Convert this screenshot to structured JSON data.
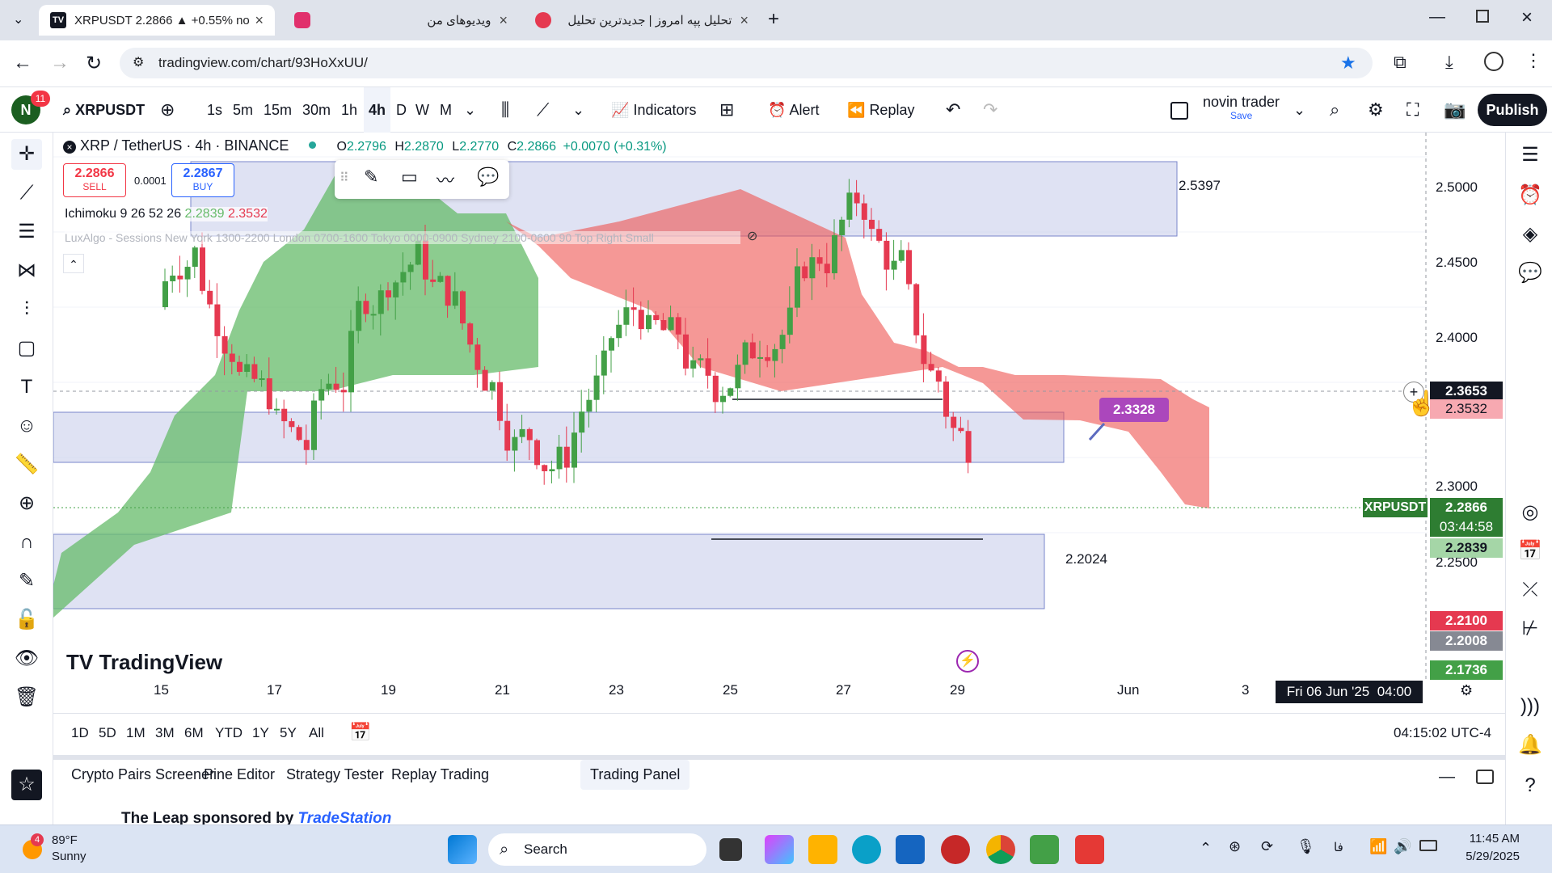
{
  "browser": {
    "tabs": [
      {
        "label": "XRPUSDT 2.2866 ▲ +0.55% no"
      },
      {
        "label": "ویدیوهای من"
      },
      {
        "label": "تحلیل پپه امروز | جدیدترین تحلیل"
      }
    ],
    "url": "tradingview.com/chart/93HoXxUU/"
  },
  "toolbar": {
    "notif_count": "11",
    "symbol": "XRPUSDT",
    "intervals": [
      "1s",
      "5m",
      "15m",
      "30m",
      "1h",
      "4h",
      "D",
      "W",
      "M"
    ],
    "indicators_label": "Indicators",
    "alert_label": "Alert",
    "replay_label": "Replay",
    "layout_name": "novin trader",
    "layout_save": "Save",
    "publish_label": "Publish"
  },
  "chart": {
    "title": "XRP / TetherUS · 4h · BINANCE",
    "ohlc": {
      "o_label": "O",
      "o": "2.2796",
      "h_label": "H",
      "h": "2.2870",
      "l_label": "L",
      "l": "2.2770",
      "c_label": "C",
      "c": "2.2866",
      "chg": "+0.0070 (+0.31%)"
    },
    "sell_price": "2.2866",
    "sell_label": "SELL",
    "spread": "0.0001",
    "buy_price": "2.2867",
    "buy_label": "BUY",
    "ichimoku": "Ichimoku 9 26 52 26",
    "ichimoku_v1": "2.2839",
    "ichimoku_v2": "2.3532",
    "luxalgo": "LuxAlgo - Sessions New York 1300-2200 London 0700-1600 Tokyo 0000-0900 Sydney 2100-0600 90 Top Right Small",
    "box_labels": [
      "2.5397",
      "2.2024"
    ],
    "purple_tag": "2.3328",
    "watermark": "TradingView",
    "price_ticks": [
      "2.5000",
      "2.4500",
      "2.4000",
      "2.3000",
      "2.2500"
    ],
    "crosshair_price": "2.3653",
    "kijun_price": "2.3532",
    "symbol_tag": "XRPUSDT",
    "last_price": "2.2866",
    "countdown": "03:44:58",
    "tenkan_price": "2.2839",
    "red_price": "2.2100",
    "gray_price": "2.2008",
    "green_price": "2.1736",
    "date_ticks": [
      "15",
      "17",
      "19",
      "21",
      "23",
      "25",
      "27",
      "29",
      "Jun",
      "3"
    ],
    "crosshair_date": "Fri 06 Jun '25",
    "crosshair_time": "04:00",
    "colors": {
      "up": "#43a047",
      "down": "#e53950",
      "cloud_green": "#66bb6a",
      "cloud_red": "#ef5350",
      "box": "#c5cae9"
    }
  },
  "range": {
    "buttons": [
      "1D",
      "5D",
      "1M",
      "3M",
      "6M",
      "YTD",
      "1Y",
      "5Y",
      "All"
    ],
    "clock": "04:15:02 UTC-4"
  },
  "panel": {
    "tabs": [
      "Crypto Pairs Screener",
      "Pine Editor",
      "Strategy Tester",
      "Replay Trading",
      "Trading Panel"
    ],
    "sponsor": "The Leap sponsored by",
    "sponsor_brand": "TradeStation"
  },
  "taskbar": {
    "weather_temp": "89°F",
    "weather_desc": "Sunny",
    "weather_badge": "4",
    "search": "Search",
    "lang": "فا",
    "time": "11:45 AM",
    "date": "5/29/2025"
  }
}
